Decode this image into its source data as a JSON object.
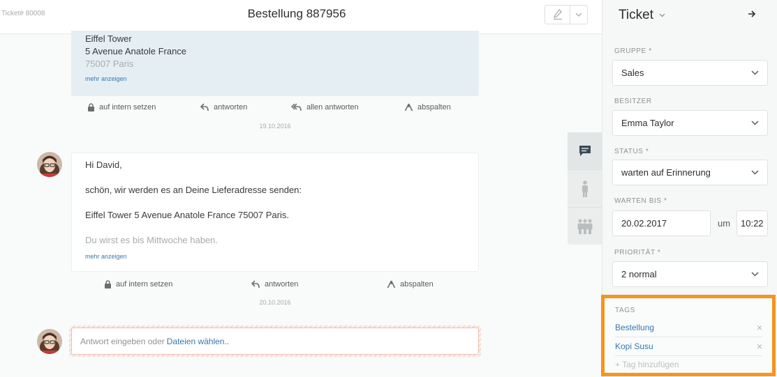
{
  "header": {
    "ticket_number": "Ticket# 80008",
    "title": "Bestellung 887956"
  },
  "articles": [
    {
      "lines": [
        "Eiffel Tower",
        "5 Avenue Anatole France",
        "75007 Paris"
      ],
      "more_label": "mehr anzeigen",
      "actions": [
        "auf intern setzen",
        "antworten",
        "allen antworten",
        "abspalten"
      ],
      "date": "19.10.2016"
    },
    {
      "lines": [
        "Hi David,",
        "schön, wir werden es an Deine Lieferadresse senden:",
        "Eiffel Tower 5 Avenue Anatole France 75007 Paris.",
        "Du wirst es bis Mittwoche haben."
      ],
      "more_label": "mehr anzeigen",
      "actions": [
        "auf intern setzen",
        "antworten",
        "abspalten"
      ],
      "date": "20.10.2016"
    }
  ],
  "reply": {
    "placeholder": "Antwort eingeben oder",
    "link": "Dateien wählen.."
  },
  "sidebar": {
    "title": "Ticket",
    "fields": {
      "gruppe": {
        "label": "GRUPPE *",
        "value": "Sales"
      },
      "besitzer": {
        "label": "BESITZER",
        "value": "Emma Taylor"
      },
      "status": {
        "label": "STATUS *",
        "value": "warten auf Erinnerung"
      },
      "warten_bis": {
        "label": "WARTEN BIS *",
        "date": "20.02.2017",
        "um": "um",
        "time": "10:22"
      },
      "prioritaet": {
        "label": "PRIORITÄT *",
        "value": "2 normal"
      }
    },
    "tags": {
      "label": "TAGS",
      "items": [
        "Bestellung",
        "Kopi Susu"
      ],
      "add_label": "+ Tag hinzufügen"
    }
  },
  "colors": {
    "highlight_border": "#f7941d",
    "link": "#3877ad",
    "article_bg": "#e5eff3"
  }
}
